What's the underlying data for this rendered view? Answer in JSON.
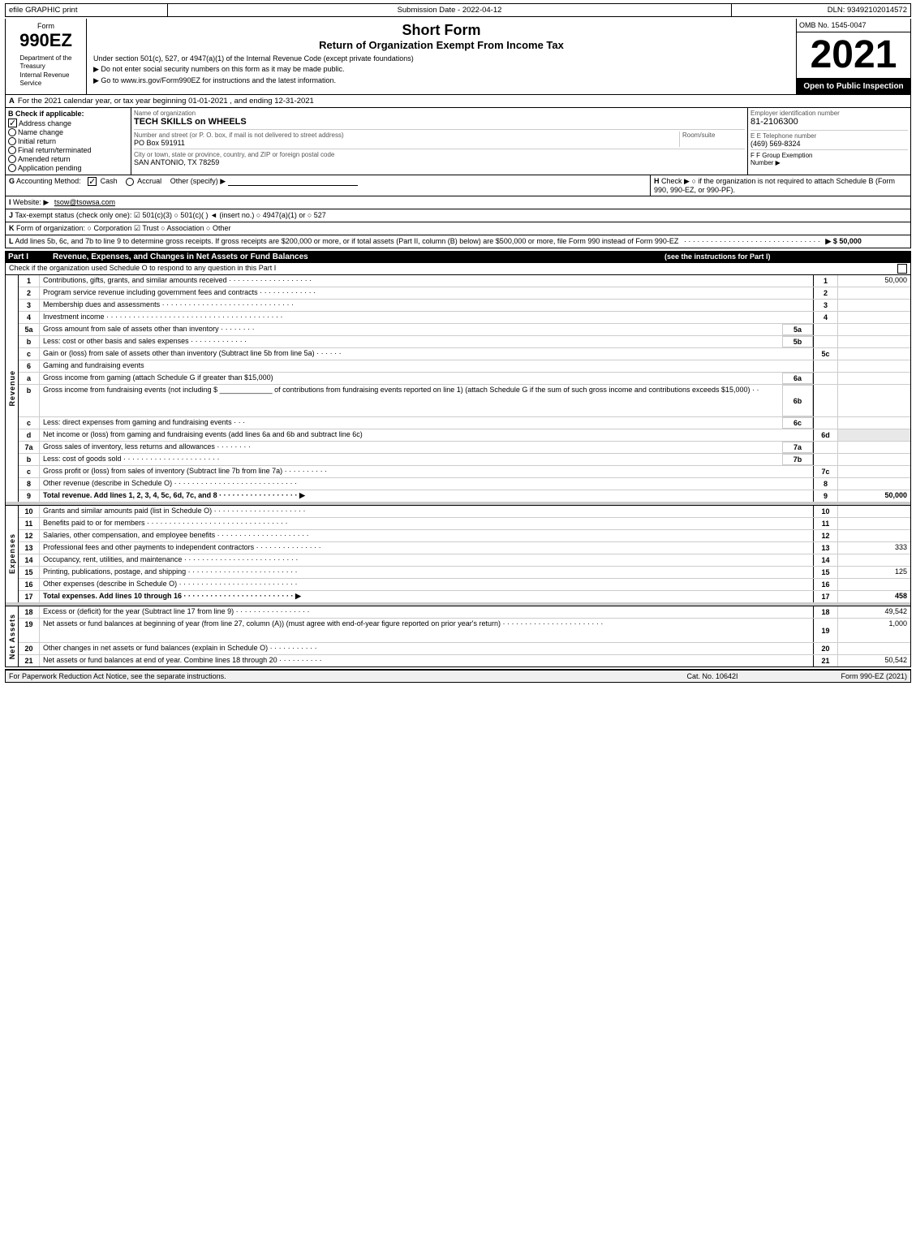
{
  "header": {
    "efile_label": "efile GRAPHIC print",
    "submission_date_label": "Submission Date - 2022-04-12",
    "dln_label": "DLN: 93492102014572",
    "omb_label": "OMB No. 1545-0047",
    "form_id": "990EZ",
    "dept_line1": "Department of the",
    "dept_line2": "Treasury",
    "dept_line3": "Internal Revenue",
    "dept_line4": "Service",
    "title_short": "Short Form",
    "title_main": "Return of Organization Exempt From Income Tax",
    "subtitle1": "Under section 501(c), 527, or 4947(a)(1) of the Internal Revenue Code (except private foundations)",
    "instruction1": "▶ Do not enter social security numbers on this form as it may be made public.",
    "instruction2": "▶ Go to www.irs.gov/Form990EZ for instructions and the latest information.",
    "year": "2021",
    "open_to_public": "Open to Public Inspection"
  },
  "section_a": {
    "label": "A",
    "text": "For the 2021 calendar year, or tax year beginning 01-01-2021 , and ending 12-31-2021"
  },
  "section_b": {
    "label": "B",
    "title": "Check if applicable:",
    "items": [
      {
        "id": "address_change",
        "label": "Address change",
        "checked": true
      },
      {
        "id": "name_change",
        "label": "Name change",
        "checked": false
      },
      {
        "id": "initial_return",
        "label": "Initial return",
        "checked": false
      },
      {
        "id": "final_return",
        "label": "Final return/terminated",
        "checked": false
      },
      {
        "id": "amended_return",
        "label": "Amended return",
        "checked": false
      },
      {
        "id": "app_pending",
        "label": "Application pending",
        "checked": false
      }
    ]
  },
  "section_c": {
    "label": "C",
    "org_name_label": "Name of organization",
    "org_name": "TECH SKILLS on WHEELS",
    "address_label": "Number and street (or P. O. box, if mail is not delivered to street address)",
    "address": "PO Box 591911",
    "room_suite_label": "Room/suite",
    "room_suite": "",
    "city_label": "City or town, state or province, country, and ZIP or foreign postal code",
    "city": "SAN ANTONIO, TX  78259"
  },
  "section_d": {
    "label": "D",
    "ein_label": "Employer identification number",
    "ein": "81-2106300",
    "phone_label": "E Telephone number",
    "phone": "(469) 569-8324",
    "group_exemption_label": "F Group Exemption",
    "group_exemption_sub": "Number",
    "group_exemption_value": ""
  },
  "section_g": {
    "label": "G",
    "prefix": "Accounting Method:",
    "cash_label": "Cash",
    "cash_checked": true,
    "accrual_label": "Accrual",
    "accrual_checked": false,
    "other_label": "Other (specify) ▶",
    "other_value": ""
  },
  "section_h": {
    "label": "H",
    "text": "Check ▶  ○ if the organization is not required to attach Schedule B (Form 990, 990-EZ, or 990-PF)."
  },
  "section_i": {
    "label": "I",
    "prefix": "Website: ▶",
    "url": "tsow@tsowsa.com"
  },
  "section_j": {
    "label": "J",
    "text": "Tax-exempt status (check only one): ☑ 501(c)(3)  ○ 501(c)(   ) ◄ (insert no.)  ○ 4947(a)(1) or  ○ 527"
  },
  "section_k": {
    "label": "K",
    "text": "Form of organization:  ○ Corporation  ☑ Trust  ○ Association  ○ Other"
  },
  "section_l": {
    "label": "L",
    "text": "Add lines 5b, 6c, and 7b to line 9 to determine gross receipts. If gross receipts are $200,000 or more, or if total assets (Part II, column (B) below) are $500,000 or more, file Form 990 instead of Form 990-EZ",
    "dots": "· · · · · · · · · · · · · · · · · · · · · · · · · · · · · · ·",
    "arrow_value": "▶ $ 50,000"
  },
  "part1": {
    "label": "Part I",
    "title": "Revenue, Expenses, and Changes in Net Assets or Fund Balances",
    "subtitle": "(see the instructions for Part I)",
    "check_text": "Check if the organization used Schedule O to respond to any question in this Part I",
    "rows": [
      {
        "num": "1",
        "desc": "Contributions, gifts, grants, and similar amounts received · · · · · · · · · · · · · · · · · · ·",
        "line_ref": "1",
        "value": "50,000"
      },
      {
        "num": "2",
        "desc": "Program service revenue including government fees and contracts · · · · · · · · · · · · ·",
        "line_ref": "2",
        "value": ""
      },
      {
        "num": "3",
        "desc": "Membership dues and assessments · · · · · · · · · · · · · · · · · · · · · · · · · · · · · ·",
        "line_ref": "3",
        "value": ""
      },
      {
        "num": "4",
        "desc": "Investment income · · · · · · · · · · · · · · · · · · · · · · · · · · · · · · · · · · · · · · · ·",
        "line_ref": "4",
        "value": ""
      },
      {
        "num": "5a",
        "desc": "Gross amount from sale of assets other than inventory · · · · · · · ·",
        "sub_col": "5a",
        "line_ref": "",
        "value": ""
      },
      {
        "num": "b",
        "desc": "Less: cost or other basis and sales expenses · · · · · · · · · · · · ·",
        "sub_col": "5b",
        "line_ref": "",
        "value": ""
      },
      {
        "num": "c",
        "desc": "Gain or (loss) from sale of assets other than inventory (Subtract line 5b from line 5a) · · · · · ·",
        "line_ref": "5c",
        "value": ""
      },
      {
        "num": "6",
        "desc": "Gaming and fundraising events",
        "line_ref": "",
        "value": ""
      },
      {
        "num": "a",
        "desc": "Gross income from gaming (attach Schedule G if greater than $15,000)",
        "sub_col": "6a",
        "line_ref": "",
        "value": ""
      },
      {
        "num": "b",
        "desc": "Gross income from fundraising events (not including $ _____________ of contributions from fundraising events reported on line 1) (attach Schedule G if the sum of such gross income and contributions exceeds $15,000)  · ·",
        "sub_col": "6b",
        "line_ref": "",
        "value": ""
      },
      {
        "num": "c",
        "desc": "Less: direct expenses from gaming and fundraising events  · · ·",
        "sub_col": "6c",
        "line_ref": "",
        "value": ""
      },
      {
        "num": "d",
        "desc": "Net income or (loss) from gaming and fundraising events (add lines 6a and 6b and subtract line 6c)",
        "line_ref": "6d",
        "value": ""
      },
      {
        "num": "7a",
        "desc": "Gross sales of inventory, less returns and allowances · · · · · · · ·",
        "sub_col": "7a",
        "line_ref": "",
        "value": ""
      },
      {
        "num": "b",
        "desc": "Less: cost of goods sold  · · · · · · · · · · · · · · · · · · · · · ·",
        "sub_col": "7b",
        "line_ref": "",
        "value": ""
      },
      {
        "num": "c",
        "desc": "Gross profit or (loss) from sales of inventory (Subtract line 7b from line 7a) · · · · · · · · · ·",
        "line_ref": "7c",
        "value": ""
      },
      {
        "num": "8",
        "desc": "Other revenue (describe in Schedule O) · · · · · · · · · · · · · · · · · · · · · · · · · · · ·",
        "line_ref": "8",
        "value": ""
      },
      {
        "num": "9",
        "desc": "Total revenue. Add lines 1, 2, 3, 4, 5c, 6d, 7c, and 8 · · · · · · · · · · · · · · · · · · ▶",
        "line_ref": "9",
        "value": "50,000",
        "bold": true
      }
    ],
    "side_label": "Revenue"
  },
  "expenses_section": {
    "side_label": "Expenses",
    "rows": [
      {
        "num": "10",
        "desc": "Grants and similar amounts paid (list in Schedule O) · · · · · · · · · · · · · · · · · · · · ·",
        "line_ref": "10",
        "value": ""
      },
      {
        "num": "11",
        "desc": "Benefits paid to or for members  · · · · · · · · · · · · · · · · · · · · · · · · · · · · · · · ·",
        "line_ref": "11",
        "value": ""
      },
      {
        "num": "12",
        "desc": "Salaries, other compensation, and employee benefits · · · · · · · · · · · · · · · · · · · · ·",
        "line_ref": "12",
        "value": ""
      },
      {
        "num": "13",
        "desc": "Professional fees and other payments to independent contractors · · · · · · · · · · · · · · ·",
        "line_ref": "13",
        "value": "333"
      },
      {
        "num": "14",
        "desc": "Occupancy, rent, utilities, and maintenance · · · · · · · · · · · · · · · · · · · · · · · · · ·",
        "line_ref": "14",
        "value": ""
      },
      {
        "num": "15",
        "desc": "Printing, publications, postage, and shipping · · · · · · · · · · · · · · · · · · · · · · · · ·",
        "line_ref": "15",
        "value": "125"
      },
      {
        "num": "16",
        "desc": "Other expenses (describe in Schedule O) · · · · · · · · · · · · · · · · · · · · · · · · · · ·",
        "line_ref": "16",
        "value": ""
      },
      {
        "num": "17",
        "desc": "Total expenses. Add lines 10 through 16  · · · · · · · · · · · · · · · · · · · · · · · · · ▶",
        "line_ref": "17",
        "value": "458",
        "bold": true
      }
    ]
  },
  "net_assets_section": {
    "side_label": "Net Assets",
    "rows": [
      {
        "num": "18",
        "desc": "Excess or (deficit) for the year (Subtract line 17 from line 9) · · · · · · · · · · · · · · · · ·",
        "line_ref": "18",
        "value": "49,542"
      },
      {
        "num": "19",
        "desc": "Net assets or fund balances at beginning of year (from line 27, column (A)) (must agree with end-of-year figure reported on prior year's return) · · · · · · · · · · · · · · · · · · · · · · ·",
        "line_ref": "19",
        "value": "1,000"
      },
      {
        "num": "20",
        "desc": "Other changes in net assets or fund balances (explain in Schedule O) · · · · · · · · · · ·",
        "line_ref": "20",
        "value": ""
      },
      {
        "num": "21",
        "desc": "Net assets or fund balances at end of year. Combine lines 18 through 20 · · · · · · · · · ·",
        "line_ref": "21",
        "value": "50,542"
      }
    ]
  },
  "footer": {
    "left": "For Paperwork Reduction Act Notice, see the separate instructions.",
    "cat_no": "Cat. No. 10642I",
    "right": "Form 990-EZ (2021)"
  }
}
